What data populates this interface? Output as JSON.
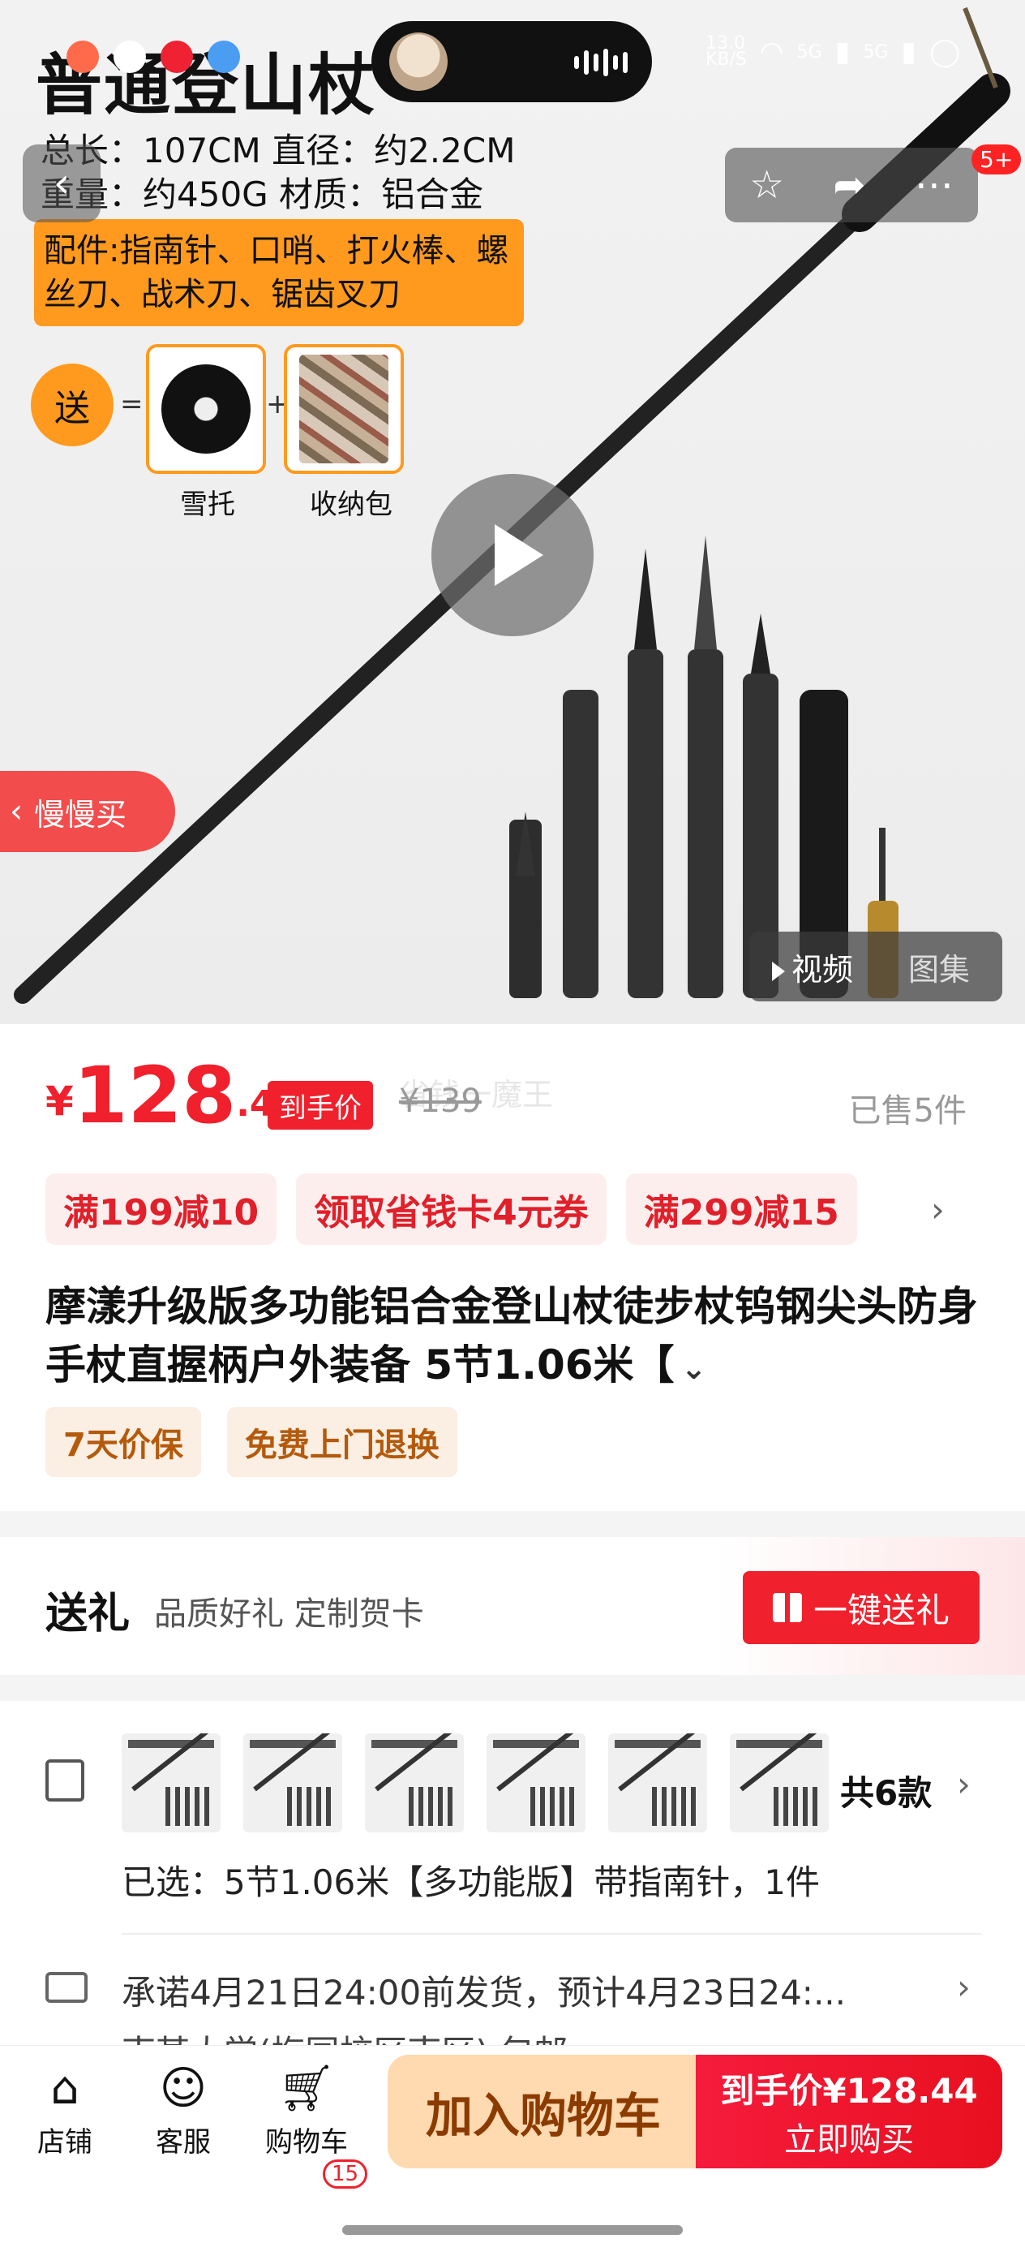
{
  "status_bar": {
    "network_speed": "13.0\nKB/S",
    "signal_1": "5G",
    "signal_2": "5G"
  },
  "hero": {
    "title": "普通登山杖",
    "spec_line1": "总长：107CM  直径：约2.2CM",
    "spec_line2": "重量：约450G 材质：铝合金",
    "accessories": "配件:指南针、口哨、打火棒、螺丝刀、战术刀、锯齿叉刀",
    "gift_badge": "送",
    "gift_eq": "=",
    "gift_plus": "+",
    "gift_item1": "雪托",
    "gift_item2": "收纳包",
    "slow_buy": "慢慢买",
    "tab_video": "视频",
    "tab_gallery": "图集",
    "action_badge": "5+"
  },
  "price": {
    "symbol": "¥",
    "integer": "128",
    "decimal": ".44",
    "tag": "到手价",
    "original": "¥139",
    "watermark": "省钱一魔王",
    "sold": "已售5件"
  },
  "promotions": [
    "满199减10",
    "领取省钱卡4元券",
    "满299减15"
  ],
  "product": {
    "title": "摩漾升级版多功能铝合金登山杖徒步杖钨钢尖头防身手杖直握柄户外装备 5节1.06米【",
    "services": [
      "7天价保",
      "免费上门退换"
    ]
  },
  "gift_section": {
    "title": "送礼",
    "subtitle": "品质好礼 定制贺卡",
    "button": "一键送礼"
  },
  "sku": {
    "count": "共6款",
    "selected": "已选：5节1.06米【多功能版】带指南针，1件"
  },
  "shipping": {
    "promise": "承诺4月21日24:00前发货，预计4月23日24:...",
    "address_partial": "南某大学(梅园校区南区)  包邮"
  },
  "bottom": {
    "store": "店铺",
    "service": "客服",
    "cart": "购物车",
    "cart_count": "15",
    "add_to_cart": "加入购物车",
    "buy_line1": "到手价¥128.44",
    "buy_line2": "立即购买"
  },
  "colors": {
    "accent_red": "#f0202c",
    "orange": "#ff9a1e",
    "cart_button": "#ffd9b0"
  }
}
